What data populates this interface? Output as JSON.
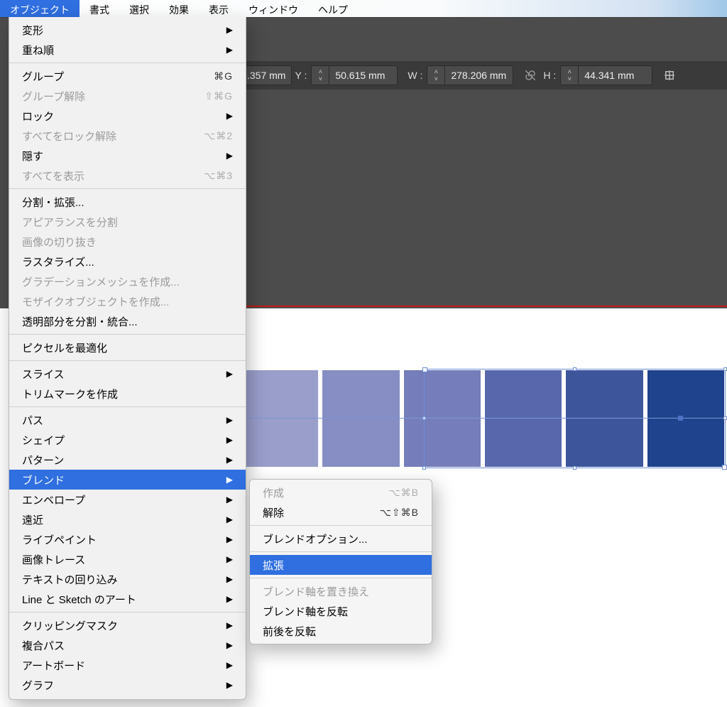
{
  "menubar": {
    "items": [
      {
        "label": "オブジェクト",
        "active": true
      },
      {
        "label": "書式"
      },
      {
        "label": "選択"
      },
      {
        "label": "効果"
      },
      {
        "label": "表示"
      },
      {
        "label": "ウィンドウ"
      },
      {
        "label": "ヘルプ"
      }
    ]
  },
  "options_bar": {
    "x_suffix": ".357 mm",
    "y_label": "Y :",
    "y_value": "50.615 mm",
    "w_label": "W :",
    "w_value": "278.206 mm",
    "h_label": "H :",
    "h_value": "44.341 mm"
  },
  "swatch_colors": [
    "#9a9ecb",
    "#878ec3",
    "#757eba",
    "#5867ab",
    "#3c559b",
    "#1f438c"
  ],
  "object_menu": {
    "groups": [
      [
        {
          "label": "変形",
          "arrow": true
        },
        {
          "label": "重ね順",
          "arrow": true
        }
      ],
      [
        {
          "label": "グループ",
          "shortcut": "⌘G"
        },
        {
          "label": "グループ解除",
          "shortcut": "⇧⌘G",
          "disabled": true
        },
        {
          "label": "ロック",
          "arrow": true
        },
        {
          "label": "すべてをロック解除",
          "shortcut": "⌥⌘2",
          "disabled": true
        },
        {
          "label": "隠す",
          "arrow": true
        },
        {
          "label": "すべてを表示",
          "shortcut": "⌥⌘3",
          "disabled": true
        }
      ],
      [
        {
          "label": "分割・拡張..."
        },
        {
          "label": "アピアランスを分割",
          "disabled": true
        },
        {
          "label": "画像の切り抜き",
          "disabled": true
        },
        {
          "label": "ラスタライズ..."
        },
        {
          "label": "グラデーションメッシュを作成...",
          "disabled": true
        },
        {
          "label": "モザイクオブジェクトを作成...",
          "disabled": true
        },
        {
          "label": "透明部分を分割・統合..."
        }
      ],
      [
        {
          "label": "ピクセルを最適化"
        }
      ],
      [
        {
          "label": "スライス",
          "arrow": true
        },
        {
          "label": "トリムマークを作成"
        }
      ],
      [
        {
          "label": "パス",
          "arrow": true
        },
        {
          "label": "シェイプ",
          "arrow": true
        },
        {
          "label": "パターン",
          "arrow": true
        },
        {
          "label": "ブレンド",
          "arrow": true,
          "selected": true
        },
        {
          "label": "エンベロープ",
          "arrow": true
        },
        {
          "label": "遠近",
          "arrow": true
        },
        {
          "label": "ライブペイント",
          "arrow": true
        },
        {
          "label": "画像トレース",
          "arrow": true
        },
        {
          "label": "テキストの回り込み",
          "arrow": true
        },
        {
          "label": "Line と Sketch のアート",
          "arrow": true
        }
      ],
      [
        {
          "label": "クリッピングマスク",
          "arrow": true
        },
        {
          "label": "複合パス",
          "arrow": true
        },
        {
          "label": "アートボード",
          "arrow": true
        },
        {
          "label": "グラフ",
          "arrow": true
        }
      ]
    ]
  },
  "blend_submenu": {
    "groups": [
      [
        {
          "label": "作成",
          "shortcut": "⌥⌘B",
          "disabled": true
        },
        {
          "label": "解除",
          "shortcut": "⌥⇧⌘B"
        }
      ],
      [
        {
          "label": "ブレンドオプション..."
        }
      ],
      [
        {
          "label": "拡張",
          "selected": true
        }
      ],
      [
        {
          "label": "ブレンド軸を置き換え",
          "disabled": true
        },
        {
          "label": "ブレンド軸を反転"
        },
        {
          "label": "前後を反転"
        }
      ]
    ]
  }
}
